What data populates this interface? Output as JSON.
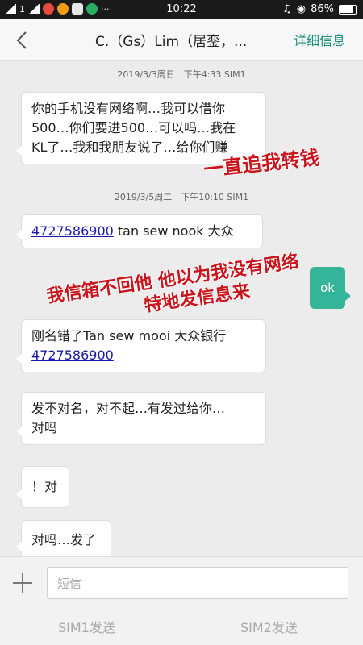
{
  "status_bar": {
    "carrier": "1",
    "time": "10:22",
    "battery": "86%"
  },
  "header": {
    "title": "C.（Gs）Lim（居銮，...",
    "detail_label": "详细信息"
  },
  "messages": [
    {
      "type": "timestamp",
      "text": "2019/3/3周日　下午4:33  SIM1"
    },
    {
      "type": "incoming",
      "lines": [
        "你的手机没有网络啊…我可以借你",
        "500…你们要进500…可以吗…我在",
        "KL了…我和我朋友说了…给你们赚"
      ]
    },
    {
      "type": "timestamp",
      "text": "2019/3/5周二　下午10:10  SIM1"
    },
    {
      "type": "incoming",
      "link": "4727586900",
      "text": " tan sew nook  大众"
    },
    {
      "type": "outgoing",
      "text": "ok"
    },
    {
      "type": "incoming",
      "line1": "刚名错了Tan sew mooi 大众银行",
      "link": "4727586900"
    },
    {
      "type": "incoming",
      "lines": [
        "发不对名，对不起…有发过给你…",
        "对吗"
      ]
    },
    {
      "type": "incoming",
      "text": "！对"
    },
    {
      "type": "incoming",
      "text": "对吗…发了"
    }
  ],
  "annotations": {
    "a1": "一直追我转钱",
    "a2_line1": "我信箱不回他 他以为我没有网络",
    "a2_line2": "特地发信息来"
  },
  "composer": {
    "placeholder": "短信",
    "sim1_label": "SIM1发送",
    "sim2_label": "SIM2发送"
  },
  "colors": {
    "accent": "#1a8f7a",
    "outgoing_bubble": "#34b59a",
    "annotation_red": "#c9141c",
    "link": "#1a1aa8"
  }
}
